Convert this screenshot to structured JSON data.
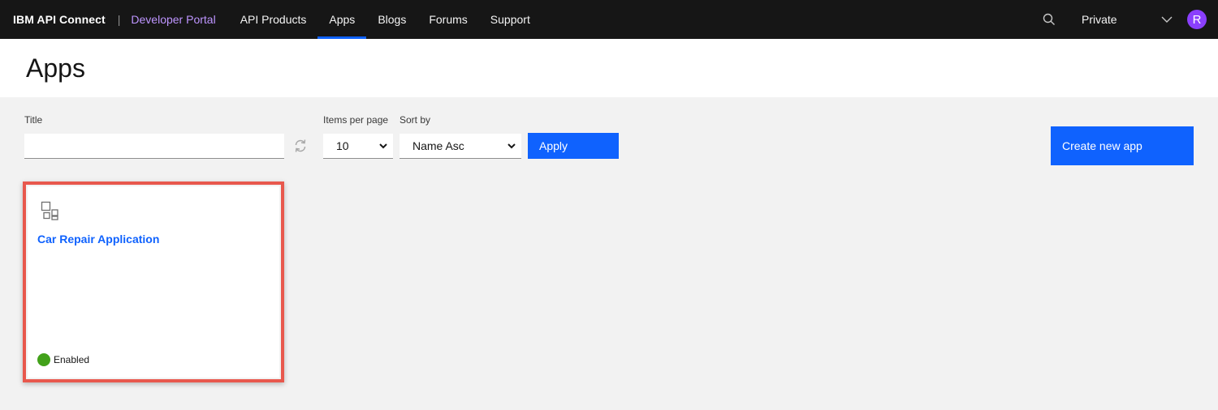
{
  "nav": {
    "brand": "IBM API Connect",
    "separator": "|",
    "portal": "Developer Portal",
    "links": [
      "API Products",
      "Apps",
      "Blogs",
      "Forums",
      "Support"
    ],
    "active": "Apps",
    "org": "Private",
    "avatar_letter": "R"
  },
  "page": {
    "title": "Apps"
  },
  "filters": {
    "title_label": "Title",
    "title_value": "",
    "items_per_page_label": "Items per page",
    "items_per_page_value": "10",
    "sort_label": "Sort by",
    "sort_value": "Name Asc",
    "apply_label": "Apply"
  },
  "actions": {
    "create_label": "Create new app"
  },
  "apps": [
    {
      "name": "Car Repair Application",
      "status": "Enabled"
    }
  ],
  "colors": {
    "nav_bg": "#161616",
    "portal_accent": "#be95ff",
    "primary": "#0f62fe",
    "highlight": "#e8584d",
    "status_enabled": "#42a11a",
    "avatar": "#8a3ffc"
  },
  "icons": {
    "search": "search-icon",
    "chevron": "chevron-down-icon",
    "refresh": "refresh-icon",
    "app": "application-icon"
  }
}
